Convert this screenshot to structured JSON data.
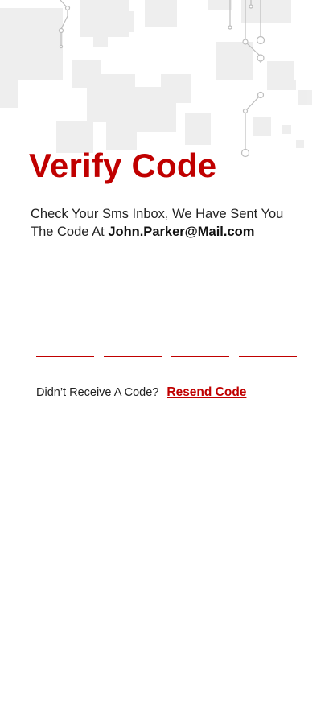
{
  "header": {
    "title": "Verify Code",
    "description_prefix": "Check Your Sms Inbox, We Have Sent You The Code At ",
    "email": "John.Parker@Mail.com"
  },
  "code_input": {
    "digits": [
      "",
      "",
      "",
      ""
    ]
  },
  "resend": {
    "question": "Didn’t Receive A Code?",
    "link_label": "Resend Code"
  },
  "colors": {
    "accent": "#c00000",
    "text": "#222222",
    "background": "#ffffff"
  }
}
